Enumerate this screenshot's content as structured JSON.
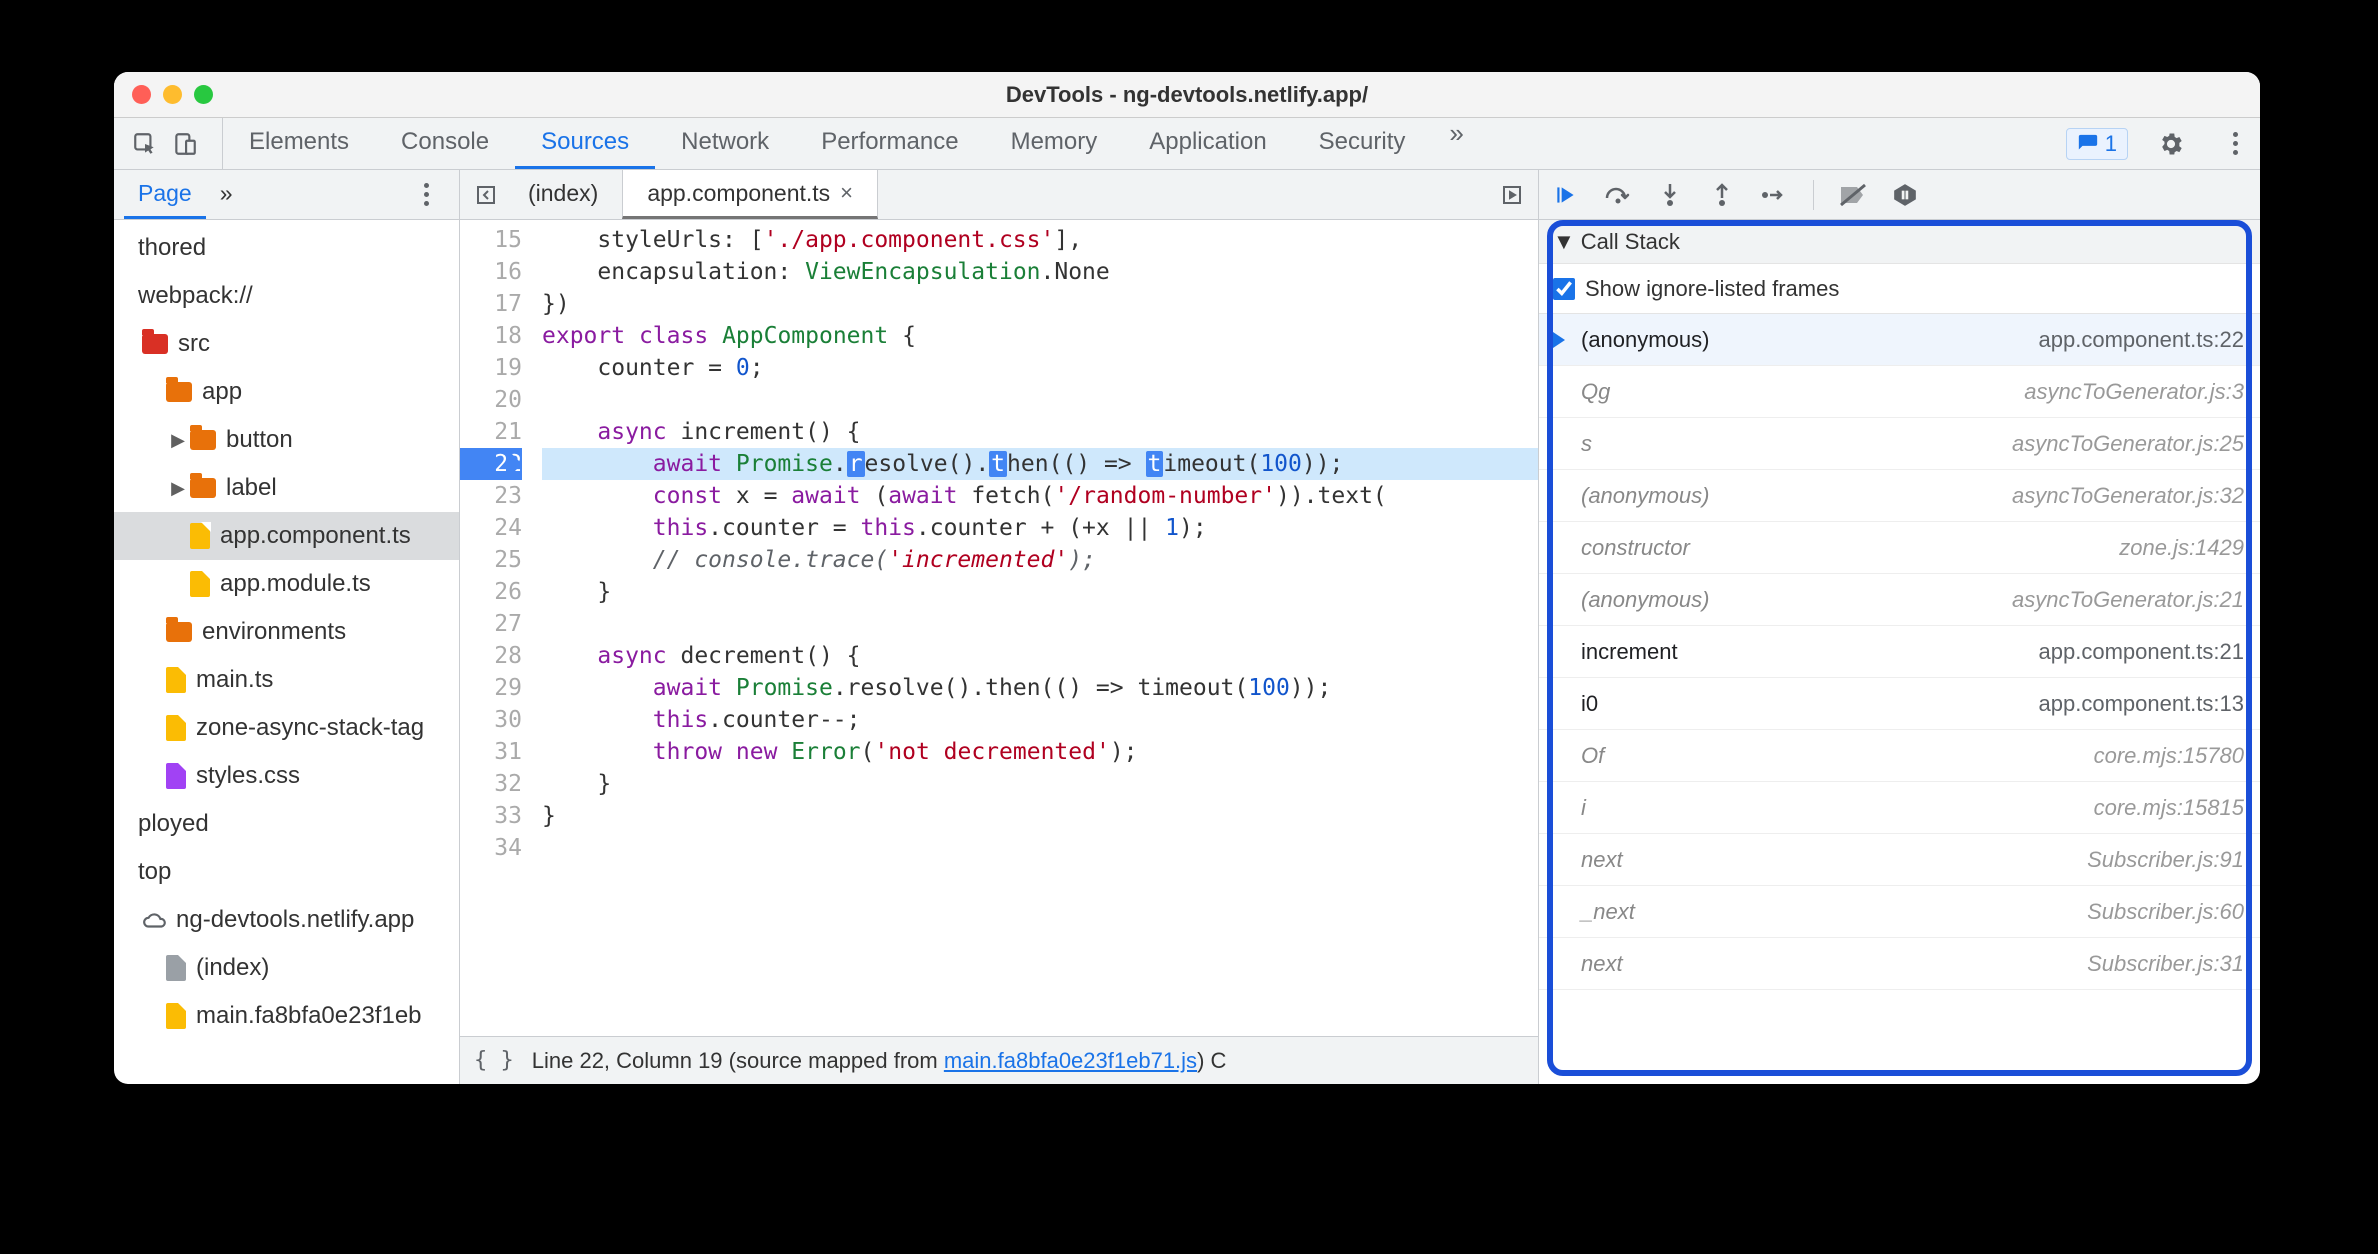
{
  "title": "DevTools - ng-devtools.netlify.app/",
  "main_tabs": [
    "Elements",
    "Console",
    "Sources",
    "Network",
    "Performance",
    "Memory",
    "Application",
    "Security"
  ],
  "main_tabs_overflow": "»",
  "main_tab_active": 2,
  "issues_count": "1",
  "nav": {
    "tab": "Page",
    "overflow": "»",
    "tree": [
      {
        "depth": 0,
        "kind": "text",
        "label": "thored"
      },
      {
        "depth": 0,
        "kind": "text",
        "label": "webpack://"
      },
      {
        "depth": 1,
        "kind": "folder-red",
        "label": "src",
        "tw": ""
      },
      {
        "depth": 2,
        "kind": "folder",
        "label": "app",
        "tw": ""
      },
      {
        "depth": 3,
        "kind": "folder",
        "label": "button",
        "tw": "▶"
      },
      {
        "depth": 3,
        "kind": "folder",
        "label": "label",
        "tw": "▶"
      },
      {
        "depth": 3,
        "kind": "file",
        "label": "app.component.ts",
        "sel": true
      },
      {
        "depth": 3,
        "kind": "file",
        "label": "app.module.ts"
      },
      {
        "depth": 2,
        "kind": "folder",
        "label": "environments"
      },
      {
        "depth": 2,
        "kind": "file",
        "label": "main.ts"
      },
      {
        "depth": 2,
        "kind": "file",
        "label": "zone-async-stack-tag"
      },
      {
        "depth": 2,
        "kind": "file-purple",
        "label": "styles.css"
      },
      {
        "depth": 0,
        "kind": "text",
        "label": "ployed"
      },
      {
        "depth": 0,
        "kind": "text",
        "label": "top"
      },
      {
        "depth": 1,
        "kind": "cloud",
        "label": "ng-devtools.netlify.app"
      },
      {
        "depth": 2,
        "kind": "file-grey",
        "label": "(index)"
      },
      {
        "depth": 2,
        "kind": "file",
        "label": "main.fa8bfa0e23f1eb"
      }
    ]
  },
  "editor": {
    "tabs": [
      {
        "label": "(index)",
        "active": false
      },
      {
        "label": "app.component.ts",
        "active": true
      }
    ],
    "first_line_no": 15,
    "breakpoint_line": 22,
    "lines": [
      {
        "raw": "    styleUrls: ['./app.component.css'],",
        "trunc": true
      },
      {
        "raw": "    encapsulation: ViewEncapsulation.None"
      },
      {
        "raw": "})"
      },
      {
        "raw": "export class AppComponent {"
      },
      {
        "raw": "    counter = 0;"
      },
      {
        "raw": ""
      },
      {
        "raw": "    async increment() {"
      },
      {
        "raw": "        await Promise.resolve().then(() => timeout(100));",
        "hl": true
      },
      {
        "raw": "        const x = await (await fetch('/random-number')).text("
      },
      {
        "raw": "        this.counter = this.counter + (+x || 1);"
      },
      {
        "raw": "        // console.trace('incremented');"
      },
      {
        "raw": "    }"
      },
      {
        "raw": ""
      },
      {
        "raw": "    async decrement() {"
      },
      {
        "raw": "        await Promise.resolve().then(() => timeout(100));"
      },
      {
        "raw": "        this.counter--;"
      },
      {
        "raw": "        throw new Error('not decremented');"
      },
      {
        "raw": "    }"
      },
      {
        "raw": "}"
      },
      {
        "raw": ""
      }
    ],
    "status_prefix": "Line 22, Column 19  (source mapped from ",
    "status_link": "main.fa8bfa0e23f1eb71.js",
    "status_suffix": ")  C"
  },
  "debugger": {
    "section": "Call Stack",
    "show_ignored_label": "Show ignore-listed frames",
    "frames": [
      {
        "fn": "(anonymous)",
        "loc": "app.component.ts:22",
        "cur": true,
        "ign": false
      },
      {
        "fn": "Qg",
        "loc": "asyncToGenerator.js:3",
        "ign": true
      },
      {
        "fn": "s",
        "loc": "asyncToGenerator.js:25",
        "ign": true
      },
      {
        "fn": "(anonymous)",
        "loc": "asyncToGenerator.js:32",
        "ign": true
      },
      {
        "fn": "constructor",
        "loc": "zone.js:1429",
        "ign": true
      },
      {
        "fn": "(anonymous)",
        "loc": "asyncToGenerator.js:21",
        "ign": true
      },
      {
        "fn": "increment",
        "loc": "app.component.ts:21",
        "ign": false
      },
      {
        "fn": "i0",
        "loc": "app.component.ts:13",
        "ign": false
      },
      {
        "fn": "Of",
        "loc": "core.mjs:15780",
        "ign": true
      },
      {
        "fn": "i",
        "loc": "core.mjs:15815",
        "ign": true
      },
      {
        "fn": "next",
        "loc": "Subscriber.js:91",
        "ign": true
      },
      {
        "fn": "_next",
        "loc": "Subscriber.js:60",
        "ign": true
      },
      {
        "fn": "next",
        "loc": "Subscriber.js:31",
        "ign": true
      }
    ]
  }
}
